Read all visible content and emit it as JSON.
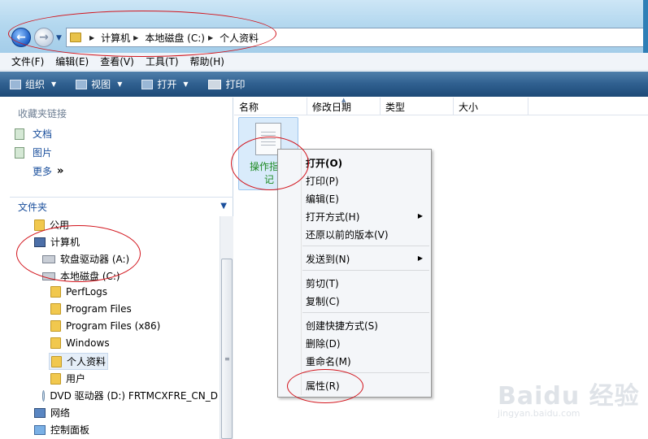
{
  "address": {
    "breadcrumbs": [
      "计算机",
      "本地磁盘 (C:)",
      "个人资料"
    ]
  },
  "menu": [
    "文件(F)",
    "编辑(E)",
    "查看(V)",
    "工具(T)",
    "帮助(H)"
  ],
  "toolbar": {
    "organize": "组织",
    "view": "视图",
    "open": "打开",
    "print": "打印"
  },
  "favorites": {
    "header": "收藏夹链接",
    "items": [
      "文档",
      "图片"
    ],
    "more": "更多"
  },
  "folders": {
    "header": "文件夹",
    "tree": [
      "公用",
      "计算机",
      "软盘驱动器 (A:)",
      "本地磁盘 (C:)",
      "PerfLogs",
      "Program Files",
      "Program Files (x86)",
      "Windows",
      "个人资料",
      "用户",
      "DVD 驱动器 (D:) FRTMCXFRE_CN_D",
      "网络",
      "控制面板"
    ]
  },
  "columns": [
    "名称",
    "修改日期",
    "类型",
    "大小"
  ],
  "file": {
    "name": "操作指南.txt 记",
    "display_top": "操作指南",
    "display_bottom": "记"
  },
  "context_menu": {
    "items": [
      "打开(O)",
      "打印(P)",
      "编辑(E)",
      "打开方式(H)",
      "还原以前的版本(V)",
      "发送到(N)",
      "剪切(T)",
      "复制(C)",
      "创建快捷方式(S)",
      "删除(D)",
      "重命名(M)",
      "属性(R)"
    ]
  },
  "watermark": {
    "main": "Baidu 经验",
    "sub": "jingyan.baidu.com"
  },
  "colors": {
    "annotation": "#d2141c",
    "toolbar": "#2f5f8f",
    "file_label": "#1e8a23"
  }
}
